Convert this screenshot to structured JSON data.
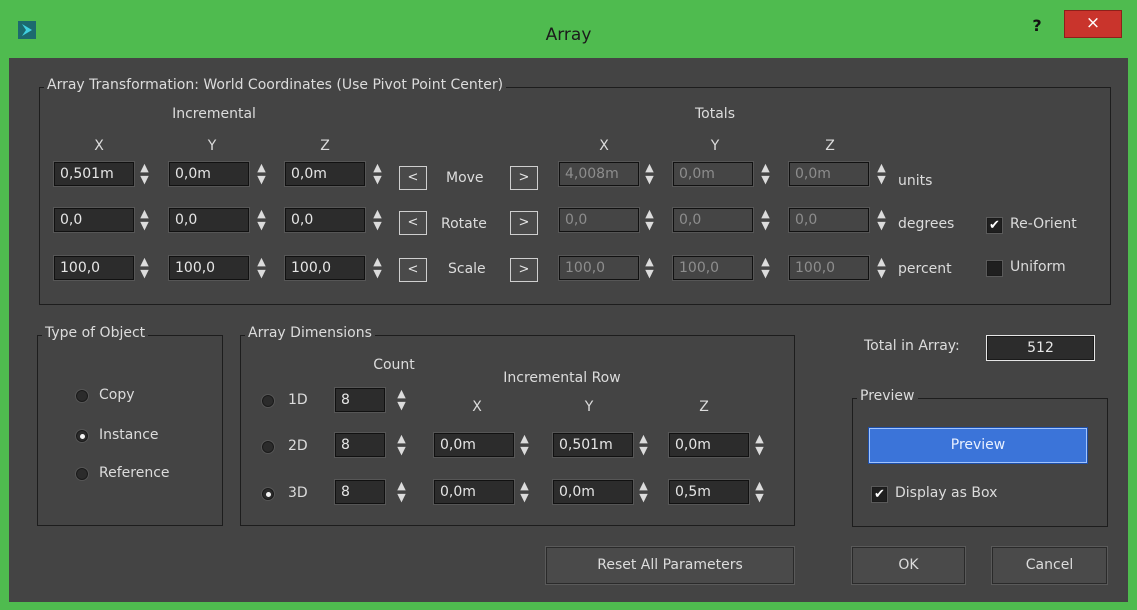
{
  "window": {
    "title": "Array",
    "help": "?",
    "close": "×"
  },
  "transformation": {
    "legend": "Array Transformation: World Coordinates (Use Pivot Point Center)",
    "incremental_label": "Incremental",
    "totals_label": "Totals",
    "axes": [
      "X",
      "Y",
      "Z"
    ],
    "rows": [
      {
        "name": "Move",
        "incremental": [
          "0,501m",
          "0,0m",
          "0,0m"
        ],
        "totals": [
          "4,008m",
          "0,0m",
          "0,0m"
        ],
        "unit": "units"
      },
      {
        "name": "Rotate",
        "incremental": [
          "0,0",
          "0,0",
          "0,0"
        ],
        "totals": [
          "0,0",
          "0,0",
          "0,0"
        ],
        "unit": "degrees"
      },
      {
        "name": "Scale",
        "incremental": [
          "100,0",
          "100,0",
          "100,0"
        ],
        "totals": [
          "100,0",
          "100,0",
          "100,0"
        ],
        "unit": "percent"
      }
    ],
    "left_arrow": "<",
    "right_arrow": ">",
    "reorient": {
      "label": "Re-Orient",
      "checked": true
    },
    "uniform": {
      "label": "Uniform",
      "checked": false
    },
    "check_glyph": "✔"
  },
  "type_of_object": {
    "legend": "Type of Object",
    "options": [
      {
        "label": "Copy",
        "selected": false
      },
      {
        "label": "Instance",
        "selected": true
      },
      {
        "label": "Reference",
        "selected": false
      }
    ]
  },
  "dimensions": {
    "legend": "Array Dimensions",
    "count_label": "Count",
    "incremental_row_label": "Incremental Row",
    "axes": [
      "X",
      "Y",
      "Z"
    ],
    "rows": [
      {
        "label": "1D",
        "selected": false,
        "count": "8",
        "values": []
      },
      {
        "label": "2D",
        "selected": false,
        "count": "8",
        "values": [
          "0,0m",
          "0,501m",
          "0,0m"
        ]
      },
      {
        "label": "3D",
        "selected": true,
        "count": "8",
        "values": [
          "0,0m",
          "0,0m",
          "0,5m"
        ]
      }
    ]
  },
  "total_in_array": {
    "label": "Total in Array:",
    "value": "512"
  },
  "preview": {
    "legend": "Preview",
    "button": "Preview",
    "display_as_box": {
      "label": "Display as Box",
      "checked": true
    }
  },
  "buttons": {
    "reset": "Reset All Parameters",
    "ok": "OK",
    "cancel": "Cancel"
  },
  "colors": {
    "window_frame": "#4fbb4f",
    "panel": "#444444",
    "close": "#c9342c",
    "accent": "#3b74d9"
  }
}
